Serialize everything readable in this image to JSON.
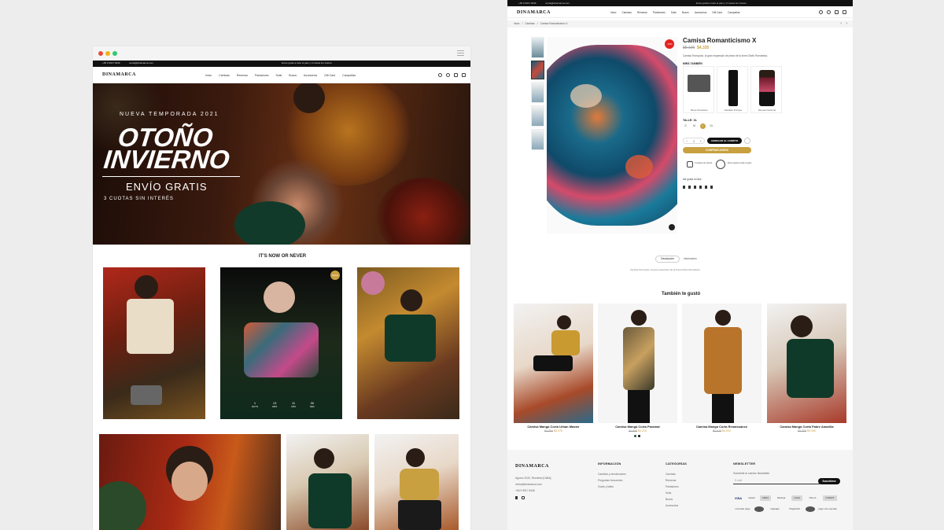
{
  "left_page": {
    "topbar": {
      "contact": "+56 9 9917 8436",
      "email": "venta@dinamarca.com",
      "promo": "Envío gratis a todo el país y 3 cuotas sin interés"
    },
    "logo": "DINAMARCA",
    "nav": [
      "Inicio",
      "Camisas",
      "Remeras",
      "Pantalones",
      "Suits",
      "Buzos",
      "Accesorios",
      "Gift Card",
      "Campañas"
    ],
    "hero": {
      "eyebrow": "NUEVA TEMPORADA 2021",
      "line1": "OTOÑO",
      "line2": "INVIERNO",
      "shipping": "ENVÍO GRATIS",
      "installments": "3 CUOTAS SIN INTERÉS"
    },
    "section_title": "IT'S NOW OR NEVER",
    "sale_badge": "SALE",
    "countdown": [
      {
        "value": "1",
        "unit": "DAYS"
      },
      {
        "value": "13",
        "unit": "HRS"
      },
      {
        "value": "11",
        "unit": "MIN"
      },
      {
        "value": "30",
        "unit": "SEC"
      }
    ]
  },
  "right_page": {
    "topbar": {
      "contact": "+56 9 9917 8436",
      "email": "venta@dinamarca.com",
      "promo": "Envío gratis a todo el país y 3 cuotas sin interés"
    },
    "logo": "DINAMARCA",
    "nav": [
      "Inicio",
      "Camisas",
      "Remeras",
      "Pantalones",
      "Suits",
      "Buzos",
      "Accesorios",
      "Gift Card",
      "Campañas"
    ],
    "breadcrumb": [
      "Inicio",
      "Camisas",
      "Camisa Romanticismo X"
    ],
    "product": {
      "title": "Camisa Romanticismo X",
      "old_price": "$5.106",
      "price": "$4.335",
      "discount_badge": "-15%",
      "description": "Camisa Tecnopolo, la gran expansión de pieza de la línea Otoño Romántico.",
      "combo_label": "MIRÁ TAMBIÉN",
      "combo_items": [
        "Boxer Romántico",
        "Pantalón Príncipe",
        "Remera Nocturna"
      ],
      "size_label": "TALLE: XL",
      "sizes": [
        "S",
        "M",
        "L",
        "XL"
      ],
      "quantity": "1",
      "add_to_cart": "AGREGAR AL CARRITO",
      "buy_now": "COMPRAR AHORA",
      "badges": [
        "3 cuotas sin interés",
        "Envío gratis a todo el país"
      ],
      "share_label": "Me gusta la idea",
      "tabs": [
        "Descripción",
        "Información"
      ],
      "tab_text": "Camisa Tecnopolo, la gran expansión de la línea Otoño Romántico."
    },
    "related_title": "También te gustó",
    "related": [
      {
        "name": "Camisa Manga Corta Urban Master",
        "old": "$4.950",
        "price": "$5.076"
      },
      {
        "name": "Camisa Manga Corta Paramat",
        "old": "$4.950",
        "price": "$3.210"
      },
      {
        "name": "Camisa Manga Corta Renaissance",
        "old": "$5.620",
        "price": "$4.910"
      },
      {
        "name": "Camisa Manga Corta Fabre Amarilla",
        "old": "$5.200",
        "price": "$3.990"
      }
    ],
    "footer": {
      "logo": "DINAMARCA",
      "address": [
        "Aguero 2020, Recoleta [CABA]",
        "venta@dinamarca.com",
        "+56 9 9917 8436"
      ],
      "info_title": "INFORMACIÓN",
      "info_items": [
        "Cambios y devoluciones",
        "Preguntas frecuentes",
        "Guías y talles"
      ],
      "cat_title": "CATEGORÍAS",
      "cat_items": [
        "Camisas",
        "Remeras",
        "Pantalones",
        "Suits",
        "Buzos",
        "Accesorios"
      ],
      "news_title": "NEWSLETTER",
      "news_text": "Suscribite al nuestro Newsletter",
      "email_placeholder": "E-mail",
      "subscribe": "Suscribirse",
      "payments": [
        "VISA",
        "master",
        "AMEX",
        "Naranja",
        "Cabal",
        "Diners",
        "CREDIT",
        "mercado pago",
        "rapipago",
        "PagoFácil",
        "pago mis cuentas"
      ]
    }
  }
}
